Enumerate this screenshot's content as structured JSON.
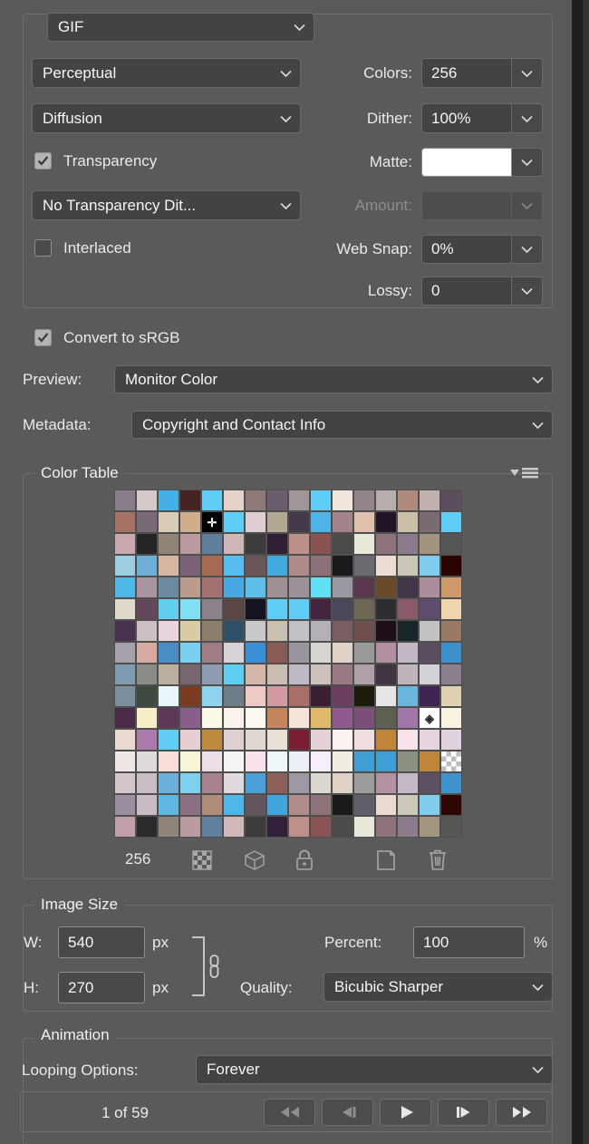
{
  "panel": {
    "format": {
      "value": "GIF",
      "icon": "chevron-down-icon"
    }
  },
  "optimize": {
    "reduction_algorithm": "Perceptual",
    "dither_algorithm": "Diffusion",
    "transparency": {
      "label": "Transparency",
      "checked": true
    },
    "transparency_dither": "No Transparency Dit...",
    "interlaced": {
      "label": "Interlaced",
      "checked": false
    },
    "colors": {
      "label": "Colors:",
      "value": "256"
    },
    "dither": {
      "label": "Dither:",
      "value": "100%"
    },
    "matte": {
      "label": "Matte:",
      "value": "",
      "color": "#ffffff"
    },
    "amount": {
      "label": "Amount:",
      "value": "",
      "disabled": true
    },
    "web_snap": {
      "label": "Web Snap:",
      "value": "0%"
    },
    "lossy": {
      "label": "Lossy:",
      "value": "0"
    }
  },
  "color_mgmt": {
    "convert_srgb": {
      "label": "Convert to sRGB",
      "checked": true
    },
    "preview": {
      "label": "Preview:",
      "value": "Monitor Color"
    },
    "metadata": {
      "label": "Metadata:",
      "value": "Copyright and Contact Info"
    }
  },
  "color_table": {
    "title": "Color Table",
    "menu_icon": "flyout-menu-icon",
    "count": "256",
    "tools": [
      {
        "name": "transparency-swatch-icon",
        "title": "Maps selected colors to transparent"
      },
      {
        "name": "web-shift-cube-icon",
        "title": "Shifts selected colors to web palette"
      },
      {
        "name": "lock-icon",
        "title": "Locks selected colors"
      },
      {
        "name": "new-color-icon",
        "title": "Adds color to palette"
      },
      {
        "name": "trash-icon",
        "title": "Deletes selected color"
      }
    ],
    "swatches": [
      "#8a7d8a",
      "#d4c9c9",
      "#45afe8",
      "#462323",
      "#5fcdf5",
      "#e5d3c8",
      "#8e7878",
      "#6b5d6b",
      "#a09598",
      "#5fcdf5",
      "#f0e6db",
      "#938489",
      "#b7adaa",
      "#b08b7d",
      "#c1b2b0",
      "#5b4f5c",
      "#a87165",
      "#7a6a78",
      "#d8cbb5",
      "#cfae89",
      "#000000",
      "#5fcdf5",
      "#decdd0",
      "#b3a791",
      "#453a4b",
      "#4fb3e6",
      "#a3838a",
      "#e0c1ae",
      "#231528",
      "#cbbfa8",
      "#7a6b72",
      "#5fcdf5",
      "#c8a9ad",
      "#252525",
      "#8f8475",
      "#ba9aa0",
      "#5f7e9c",
      "#cfb6b7",
      "#3b3b3b",
      "#2f1f33",
      "#bc8f88",
      "#8a5352",
      "#4a4a4a",
      "#e9e6da",
      "#8e7279",
      "#8c7b8b",
      "#a3947f",
      "#555555",
      "#9ecce0",
      "#6cb0d8",
      "#d7b5a3",
      "#7b6174",
      "#a46a52",
      "#57bdee",
      "#6d5458",
      "#41a8e0",
      "#b08a8a",
      "#8c7278",
      "#1a1a1a",
      "#6a6a70",
      "#eedbd3",
      "#cbc7b7",
      "#7ecdee",
      "#2b0303",
      "#4fb6e8",
      "#a794a0",
      "#6d8aa3",
      "#bb9c8b",
      "#a47070",
      "#4aa8e0",
      "#5dbfea",
      "#9f9093",
      "#9c9099",
      "#5fe0f5",
      "#9a98a0",
      "#58384a",
      "#6b4a2a",
      "#413648",
      "#ab8d9e",
      "#cf9a6b",
      "#dfdacb",
      "#64475a",
      "#63cdf0",
      "#82e0f5",
      "#8b8389",
      "#5a4645",
      "#141420",
      "#5fcdf5",
      "#5fcdf5",
      "#45243f",
      "#4b4758",
      "#6e6552",
      "#2d2d32",
      "#8a5a68",
      "#5d4c6c",
      "#f0d6ae",
      "#4a3151",
      "#ccc0c2",
      "#ead5de",
      "#d9cba4",
      "#8b7e6a",
      "#2f5066",
      "#c9c9c9",
      "#c9c0b1",
      "#c4c0c8",
      "#b3b0b8",
      "#7a5d62",
      "#6f4e4e",
      "#1d0f19",
      "#182529",
      "#c2c2c2",
      "#9a7a66",
      "#a7a1ab",
      "#d8aaa4",
      "#4a8cc4",
      "#79d0ef",
      "#a07d85",
      "#d7d2d6",
      "#3a8fd4",
      "#8a5b56",
      "#9b95a0",
      "#d7d5cf",
      "#e0d2c7",
      "#9a9a9a",
      "#b08fa0",
      "#c2b7c6",
      "#5a4e60",
      "#3b90cd",
      "#7f9bb0",
      "#8a8a86",
      "#bbb0a0",
      "#77666e",
      "#8f9bb0",
      "#5ecdf0",
      "#d3b7a9",
      "#ccbdb4",
      "#c0b9c4",
      "#cdc0bd",
      "#9a7a85",
      "#b0a0a8",
      "#3e3540",
      "#c0b4ba",
      "#d4d1d8",
      "#8e7f8e",
      "#7b8fa1",
      "#3e4a3f",
      "#e8f6fa",
      "#7a3b20",
      "#8fd3ee",
      "#6f7d8a",
      "#efc9c5",
      "#cf9aa0",
      "#a86f68",
      "#3b1e32",
      "#6b3d60",
      "#1c1a08",
      "#e6e6e6",
      "#6bb6dd",
      "#3f2350",
      "#ded0b0",
      "#4a2a48",
      "#f5efc8",
      "#5b3858",
      "#8a5e8a",
      "#fbf9e8",
      "#fbf2ec",
      "#fdfaf2",
      "#c4855f",
      "#f6e4d8",
      "#e0b96a",
      "#8f5a90",
      "#7a4f7a",
      "#5c5f52",
      "#a077a8",
      "#ffffff",
      "#faf3e2",
      "#ead9d1",
      "#aa7aab",
      "#5fcdf5",
      "#e6cfd3",
      "#c08a3c",
      "#ded0d0",
      "#ded8d0",
      "#e9e0d5",
      "#7b1e33",
      "#e4d2d6",
      "#faf3f2",
      "#f0dfe0",
      "#c08536",
      "#f6e4ea",
      "#e8d4e0",
      "#e0d2de",
      "#f0e6e6",
      "#dedada",
      "#f8ded8",
      "#f8f4d8",
      "#ecdfe8",
      "#f4f4f4",
      "#fae2ea",
      "#eef8fa",
      "#eceef8",
      "#f6eef8",
      "#f0eee2",
      "#3f9ed4",
      "#3f9ed4",
      "#8a9180",
      "#c08536",
      "#ffffff",
      "#d2c6cc",
      "#c9bcc4",
      "#6bb0dc",
      "#7fd0ee",
      "#a8828c",
      "#e0dade",
      "#4a9fd8",
      "#8c5f5a",
      "#9e98a2",
      "#d9d7d0",
      "#dfd1c6",
      "#9c9c9c",
      "#b291a2",
      "#c4b9c8",
      "#5c5062",
      "#3d92cf",
      "#9a8f9e",
      "#c8bcc4",
      "#5fb6e0",
      "#8a7080",
      "#b08d7a",
      "#4fb6e8",
      "#645460",
      "#42a4dc",
      "#b08c8c",
      "#8e7478",
      "#191919",
      "#606068",
      "#ecd9d2",
      "#cdc9b9",
      "#80cdee",
      "#2d0505",
      "#c0a0a8",
      "#2b2b2b",
      "#90857a",
      "#bb9ba2",
      "#60809e",
      "#d0b8b8",
      "#3c3c3c",
      "#30203a",
      "#bd9088",
      "#8b5454",
      "#4b4b4b",
      "#eae7db",
      "#8f737a",
      "#8d7c8c",
      "#a4957f",
      "#565656"
    ],
    "marked_swatch_index": 20,
    "marked_swatch_glyph": "✛",
    "web_swatch_index": 174,
    "web_swatch_glyph": "◈",
    "checker_swatch_index": 207
  },
  "image_size": {
    "title": "Image Size",
    "width": {
      "label": "W:",
      "value": "540",
      "unit": "px"
    },
    "height": {
      "label": "H:",
      "value": "270",
      "unit": "px"
    },
    "link_icon": "chain-link-icon",
    "percent": {
      "label": "Percent:",
      "value": "100",
      "unit": "%"
    },
    "quality": {
      "label": "Quality:",
      "value": "Bicubic Sharper"
    }
  },
  "animation": {
    "title": "Animation",
    "looping": {
      "label": "Looping Options:",
      "value": "Forever"
    },
    "frame_status": "1 of 59",
    "buttons": [
      {
        "name": "first-frame-button",
        "glyph": "rewind",
        "disabled": true
      },
      {
        "name": "previous-frame-button",
        "glyph": "prev",
        "disabled": true
      },
      {
        "name": "play-button",
        "glyph": "play",
        "disabled": false
      },
      {
        "name": "next-frame-button",
        "glyph": "next",
        "disabled": false
      },
      {
        "name": "last-frame-button",
        "glyph": "forward",
        "disabled": false
      }
    ]
  }
}
